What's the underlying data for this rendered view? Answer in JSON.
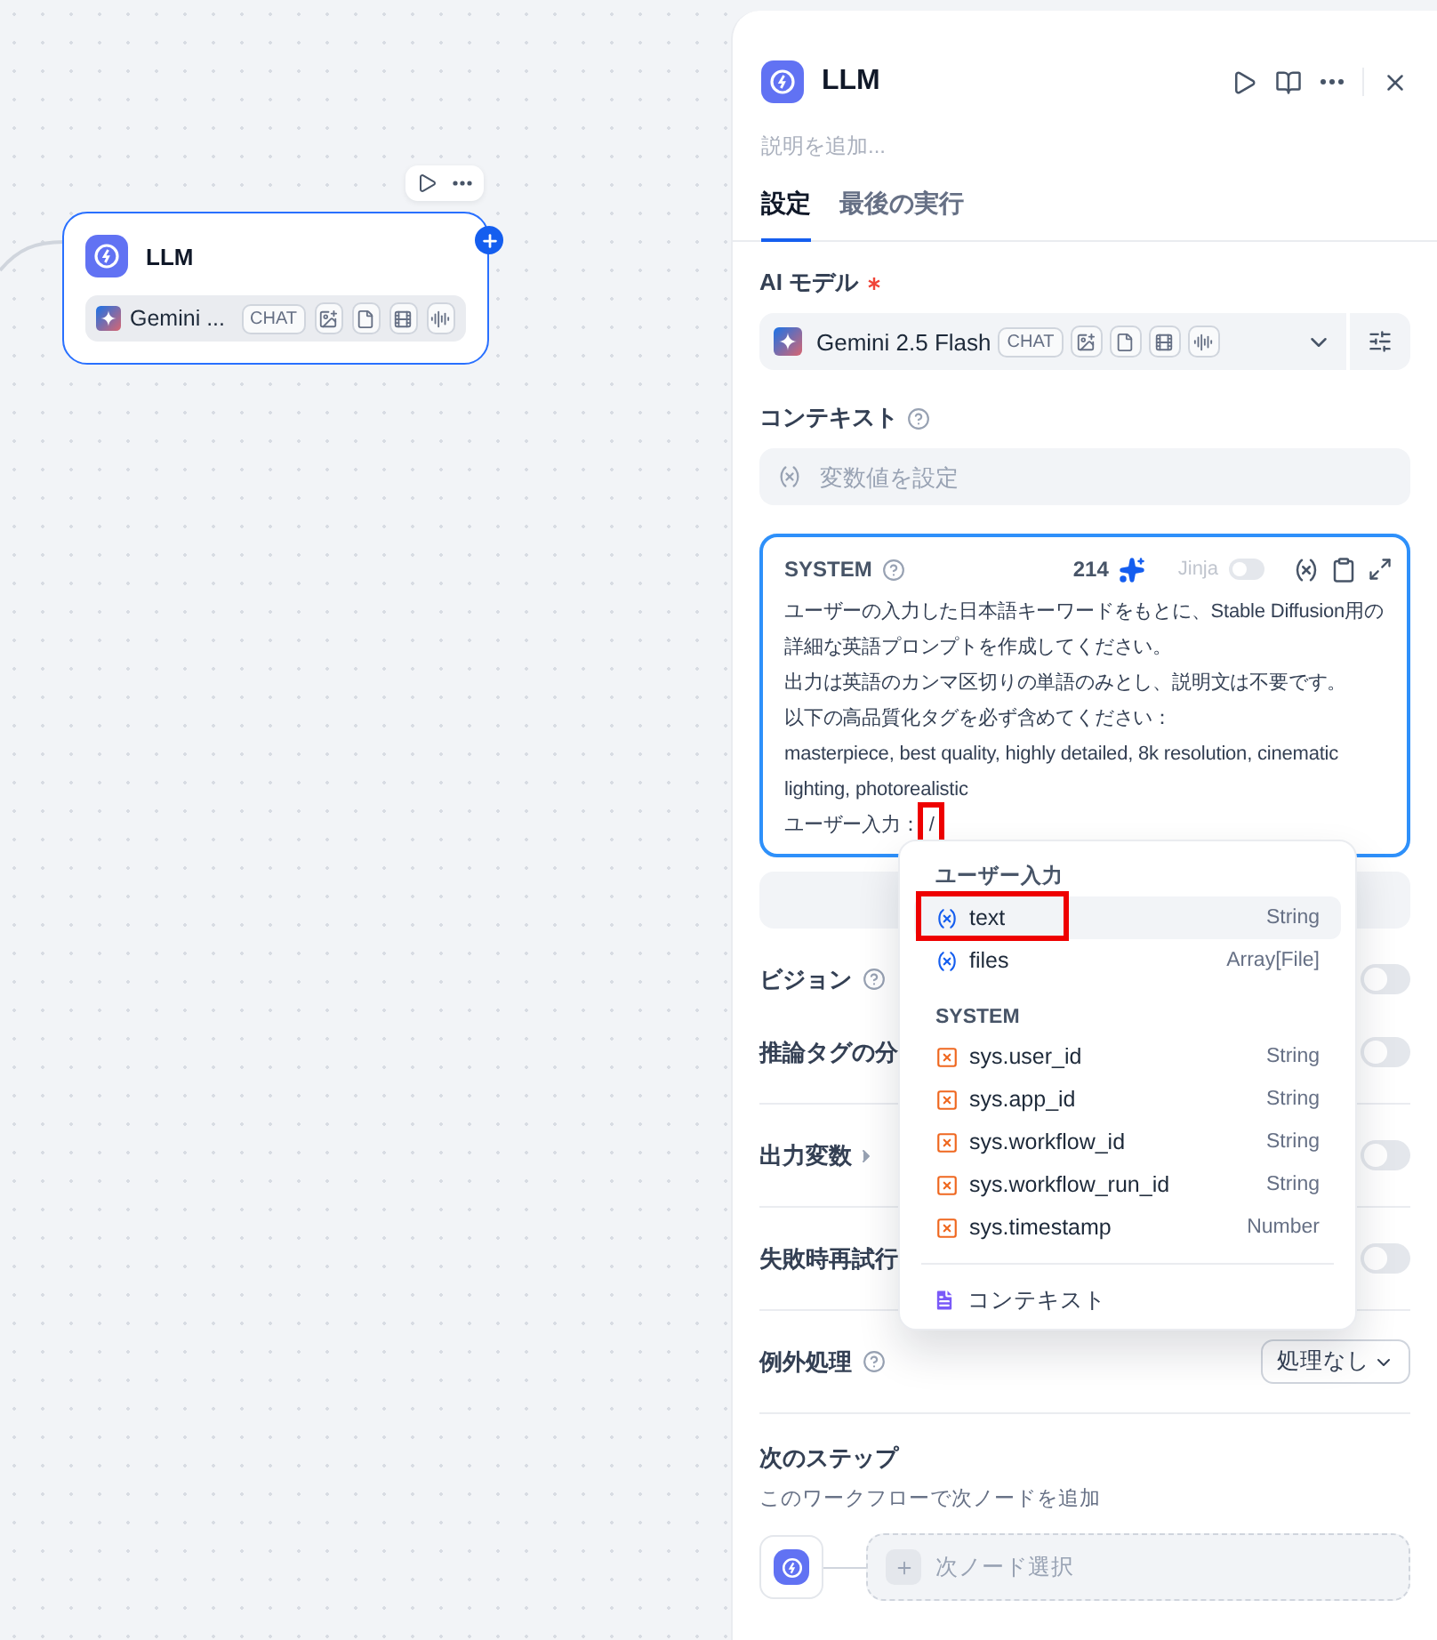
{
  "canvas": {
    "node": {
      "title": "LLM",
      "model": "Gemini ...",
      "mode": "CHAT",
      "selected": true
    }
  },
  "panel": {
    "title": "LLM",
    "description_placeholder": "説明を追加...",
    "tabs": [
      {
        "label": "設定",
        "selected": true
      },
      {
        "label": "最後の実行",
        "selected": false
      }
    ],
    "model_field": {
      "label": "AI モデル",
      "required": true,
      "value": "Gemini 2.5 Flash",
      "mode": "CHAT"
    },
    "context": {
      "label": "コンテキスト",
      "placeholder": "変数値を設定"
    },
    "system_prompt": {
      "label": "SYSTEM",
      "count": "214",
      "jinja_label": "Jinja",
      "jinja_on": false,
      "focused": true,
      "paragraphs": [
        "ユーザーの入力した日本語キーワードをもとに、Stable Diffusion用の詳細な英語プロンプトを作成してください。",
        "出力は英語のカンマ区切りの単語のみとし、説明文は不要です。",
        "以下の高品質化タグを必ず含めてください：",
        "masterpiece, best quality, highly detailed, 8k resolution, cinematic lighting, photorealistic"
      ],
      "input_label": "ユーザー入力：",
      "typed": "/",
      "typed_highlighted": true
    },
    "toggle_sections": [
      [
        {
          "label": "ビジョン",
          "kind": "help",
          "on": false
        },
        {
          "label": "推論タグの分",
          "kind": "plain",
          "on": false
        }
      ],
      [
        {
          "label": "出力変数",
          "kind": "caret",
          "on": false
        }
      ],
      [
        {
          "label": "失敗時再試行",
          "kind": "plain",
          "on": false
        }
      ]
    ],
    "exception": {
      "label": "例外処理",
      "value": "処理なし"
    },
    "next_step": {
      "title": "次のステップ",
      "subtitle": "このワークフローで次ノードを追加",
      "placeholder": "次ノード選択"
    }
  },
  "variable_menu": {
    "groups": [
      {
        "title": "ユーザー入力",
        "items": [
          {
            "name": "text",
            "type": "String",
            "kind": "user",
            "selected": true,
            "highlighted": true
          },
          {
            "name": "files",
            "type": "Array[File]",
            "kind": "user",
            "selected": false,
            "highlighted": false
          }
        ]
      },
      {
        "title": "SYSTEM",
        "items": [
          {
            "name": "sys.user_id",
            "type": "String",
            "kind": "system",
            "selected": false,
            "highlighted": false
          },
          {
            "name": "sys.app_id",
            "type": "String",
            "kind": "system",
            "selected": false,
            "highlighted": false
          },
          {
            "name": "sys.workflow_id",
            "type": "String",
            "kind": "system",
            "selected": false,
            "highlighted": false
          },
          {
            "name": "sys.workflow_run_id",
            "type": "String",
            "kind": "system",
            "selected": false,
            "highlighted": false
          },
          {
            "name": "sys.timestamp",
            "type": "Number",
            "kind": "system",
            "selected": false,
            "highlighted": false
          }
        ]
      }
    ],
    "footer": "コンテキスト"
  }
}
